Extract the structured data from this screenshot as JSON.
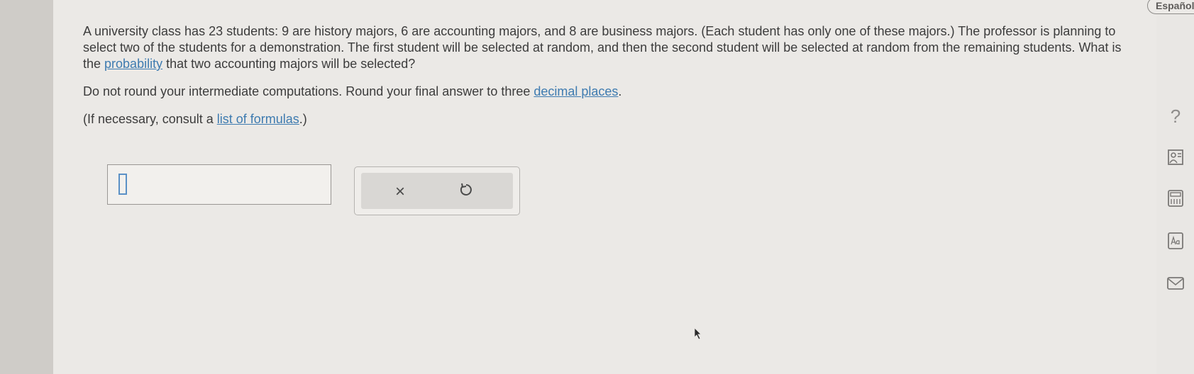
{
  "question": {
    "paragraph1_text": "A university class has 23 students: 9 are history majors, 6 are accounting majors, and 8 are business majors. (Each student has only one of these majors.) The professor is planning to select two of the students for a demonstration. The first student will be selected at random, and then the second student will be selected at random from the remaining students. What is the ",
    "paragraph1_link": "probability",
    "paragraph1_end": " that two accounting majors will be selected?",
    "paragraph2_text": "Do not round your intermediate computations. Round your final answer to three ",
    "paragraph2_link": "decimal places",
    "paragraph2_end": ".",
    "paragraph3_text": "(If necessary, consult a ",
    "paragraph3_link": "list of formulas",
    "paragraph3_end": ".)"
  },
  "answer": {
    "value": ""
  },
  "toolbar": {
    "clear_symbol": "×",
    "undo_symbol": "↺"
  },
  "rail": {
    "language_label": "Español",
    "help_symbol": "?"
  }
}
